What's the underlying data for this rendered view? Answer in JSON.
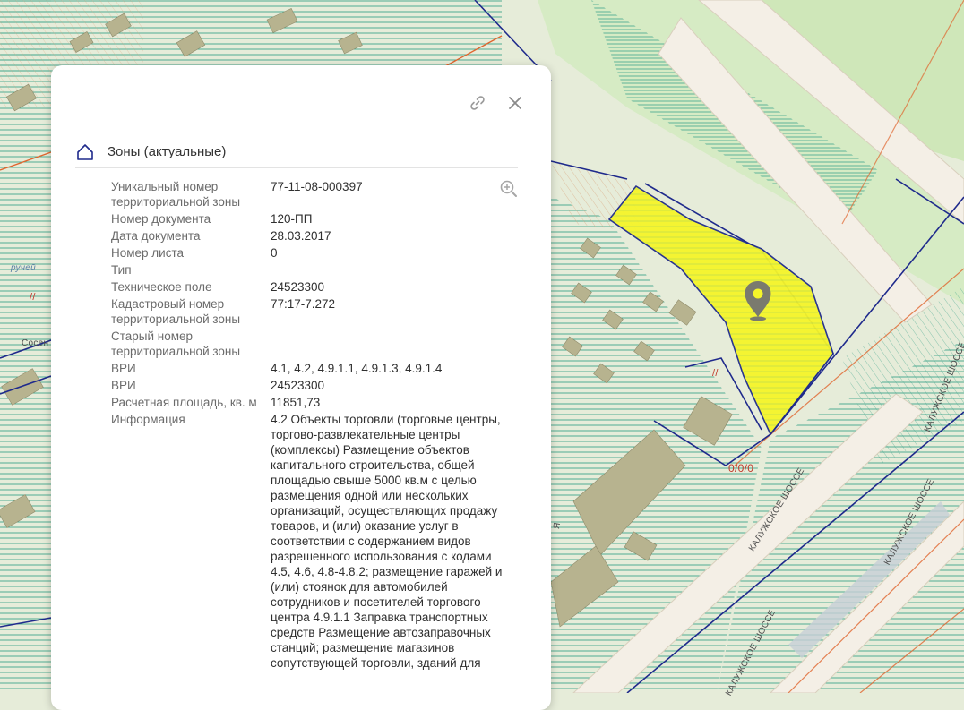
{
  "panel": {
    "title": "Зоны (актуальные)",
    "link_icon": "link-icon",
    "close_icon": "close-icon",
    "zone_icon": "home-outline-icon",
    "zoom_icon": "zoom-in-icon",
    "rows": [
      {
        "key": "Уникальный номер территориальной зоны",
        "value": "77-11-08-000397"
      },
      {
        "key": "Номер документа",
        "value": "120-ПП"
      },
      {
        "key": "Дата документа",
        "value": "28.03.2017"
      },
      {
        "key": "Номер листа",
        "value": "0"
      },
      {
        "key": "Тип",
        "value": ""
      },
      {
        "key": "Техническое поле",
        "value": "24523300"
      },
      {
        "key": "Кадастровый номер территориальной зоны",
        "value": "77:17-7.272"
      },
      {
        "key": "Старый номер территориальной зоны",
        "value": ""
      },
      {
        "key": "ВРИ",
        "value": "4.1, 4.2, 4.9.1.1, 4.9.1.3, 4.9.1.4"
      },
      {
        "key": "ВРИ",
        "value": "24523300"
      },
      {
        "key": "Расчетная площадь, кв. м",
        "value": "11851,73"
      },
      {
        "key": "Информация",
        "value": "4.2 Объекты торговли (торговые центры, торгово-развлекательные центры (комплексы) Размещение объектов капитального строительства, общей площадью свыше 5000 кв.м с целью размещения одной или нескольких организаций, осуществляющих продажу товаров, и (или) оказание услуг в соответствии с содержанием видов разрешенного использования с кодами 4.5, 4.6, 4.8-4.8.2; размещение гаражей и (или) стоянок для автомобилей сотрудников и посетителей торгового центра 4.9.1.1 Заправка транспортных средств Размещение автозаправочных станций; размещение магазинов сопутствующей торговли, зданий для"
      }
    ]
  },
  "map": {
    "labels": {
      "stream": "ручей",
      "sosn": "Сосен",
      "road_1": "КАЛУЖСКОЕ ШОССЕ",
      "road_2": "КАЛУЖСКОЕ ШОССЕ",
      "road_3": "КАЛУЖСКОЕ ШОССЕ",
      "road_4": "КАЛУЖСКОЕ ШОССЕ",
      "marker_code": "0/0/0",
      "mark_a": "//",
      "mark_b": "//",
      "edge_text": "Я"
    },
    "marker_icon": "map-pin-icon",
    "colors": {
      "land": "#e6ecd9",
      "green_area": "#cfe7b9",
      "hatch_teal": "#3fa58b",
      "building": "#b7b38f",
      "road": "#f4efe6",
      "road_edge": "#d9cfbd",
      "boundary_blue": "#1f2a8c",
      "highlight": "#f5f52a",
      "marker": "#7a7a6e",
      "orange_line": "#e0652e",
      "panel_bg": "#ffffff"
    }
  }
}
